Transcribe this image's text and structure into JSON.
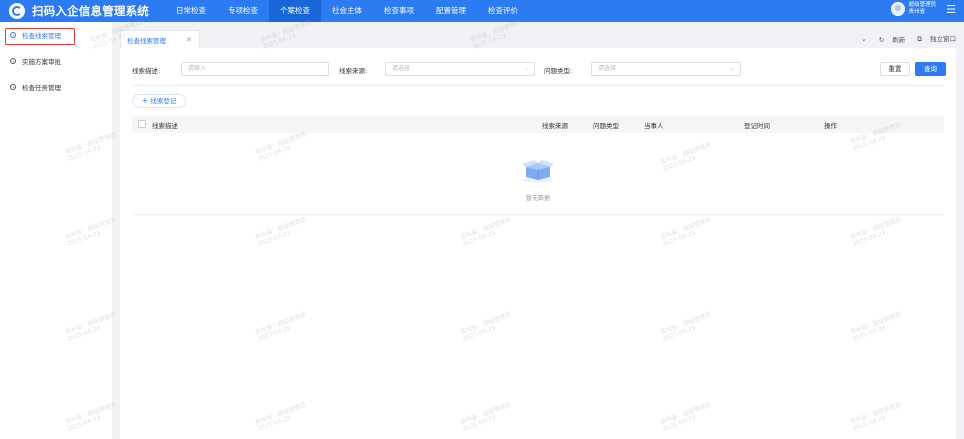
{
  "app": {
    "title": "扫码入企信息管理系统"
  },
  "nav": [
    {
      "label": "日常检查"
    },
    {
      "label": "专项检查"
    },
    {
      "label": "个案检查",
      "active": true
    },
    {
      "label": "社会主体"
    },
    {
      "label": "检查事项"
    },
    {
      "label": "配置管理"
    },
    {
      "label": "检查评价"
    }
  ],
  "user": {
    "name": "超级管理员",
    "region": "贵州省"
  },
  "sidebar": {
    "items": [
      {
        "label": "检查线索管理",
        "active": true
      },
      {
        "label": "实施方案审批"
      },
      {
        "label": "检查任务管理"
      }
    ]
  },
  "tabs": {
    "active": {
      "label": "检查线索管理"
    },
    "refresh_label": "刷新",
    "popout_label": "独立窗口"
  },
  "filters": {
    "desc_label": "线索描述:",
    "desc_placeholder": "请输入",
    "source_label": "线索来源:",
    "source_placeholder": "请选择",
    "type_label": "问题类型:",
    "type_placeholder": "请选择",
    "reset_label": "重置",
    "search_label": "查询"
  },
  "actions": {
    "add_label": "线索登记"
  },
  "table": {
    "columns": [
      "线索描述",
      "线索来源",
      "问题类型",
      "当事人",
      "登记时间",
      "操作"
    ],
    "empty_text": "暂无数据"
  },
  "watermark": {
    "line1": "贵州省：超级管理员",
    "line2": "2025-04-29"
  },
  "colors": {
    "primary": "#2d7bf2",
    "highlight": "#e33b3b"
  }
}
